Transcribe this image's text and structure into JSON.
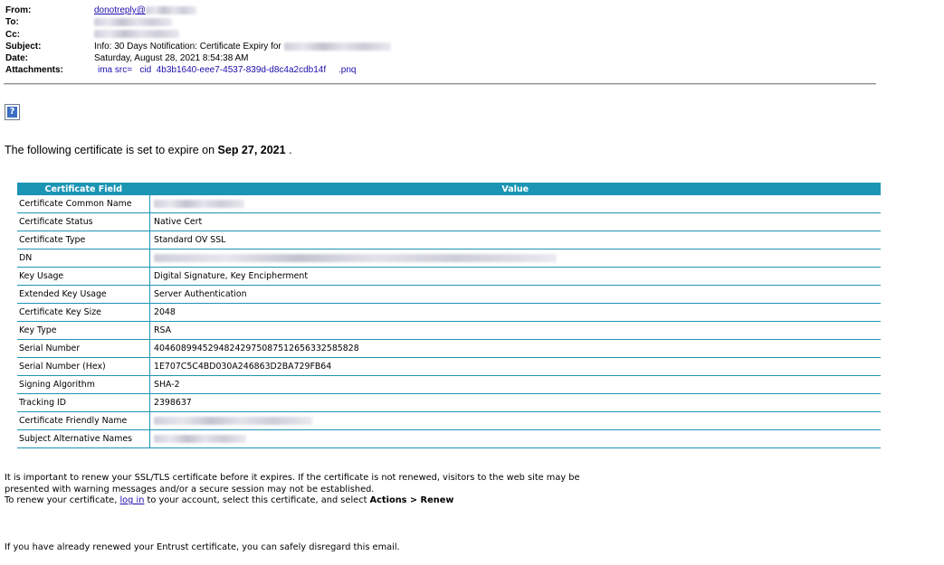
{
  "header": {
    "from_label": "From:",
    "from_value": "donotreply@",
    "to_label": "To:",
    "cc_label": "Cc:",
    "subject_label": "Subject:",
    "subject_value": "Info: 30 Days Notification: Certificate Expiry for",
    "date_label": "Date:",
    "date_value": "Saturday, August 28, 2021 8:54:38 AM",
    "attachments_label": "Attachments:",
    "attachments_value": "ima src=   cid  4b3b1640-eee7-4537-839d-d8c4a2cdb14f     .pnq"
  },
  "help_icon_glyph": "?",
  "intro": {
    "text": "The following certificate is set to expire on ",
    "date": "Sep 27, 2021",
    "tail": " ."
  },
  "table": {
    "headers": [
      "Certificate Field",
      "Value"
    ],
    "rows": [
      {
        "field": "Certificate Common Name",
        "value": "",
        "redacted": true
      },
      {
        "field": "Certificate Status",
        "value": "Native Cert"
      },
      {
        "field": "Certificate Type",
        "value": "Standard OV SSL"
      },
      {
        "field": "DN",
        "value": "",
        "redacted": true
      },
      {
        "field": "Key Usage",
        "value": "Digital Signature, Key Encipherment"
      },
      {
        "field": "Extended Key Usage",
        "value": "Server Authentication"
      },
      {
        "field": "Certificate Key Size",
        "value": "2048"
      },
      {
        "field": "Key Type",
        "value": "RSA"
      },
      {
        "field": "Serial Number",
        "value": "40460899452948242975087512656332585828"
      },
      {
        "field": "Serial Number (Hex)",
        "value": "1E707C5C4BD030A246863D2BA729FB64"
      },
      {
        "field": "Signing Algorithm",
        "value": "SHA-2"
      },
      {
        "field": "Tracking ID",
        "value": "2398637"
      },
      {
        "field": "Certificate Friendly Name",
        "value": "",
        "redacted": true
      },
      {
        "field": "Subject Alternative Names",
        "value": "",
        "redacted": true
      }
    ]
  },
  "body": {
    "para1": "It is important to renew your SSL/TLS certificate before it expires. If the certificate is not renewed, visitors to the web site may be",
    "para1b": "presented with warning messages and/or a secure session may not be established.",
    "renew_prefix": "To renew your certificate, ",
    "login_link": "log in",
    "renew_middle": " to your account, select this certificate, and select ",
    "renew_action": "Actions > Renew",
    "closing": "If you have already renewed your Entrust certificate, you can safely disregard this email."
  },
  "colors": {
    "accent": "#1c95b5",
    "link": "#1a0dab"
  }
}
